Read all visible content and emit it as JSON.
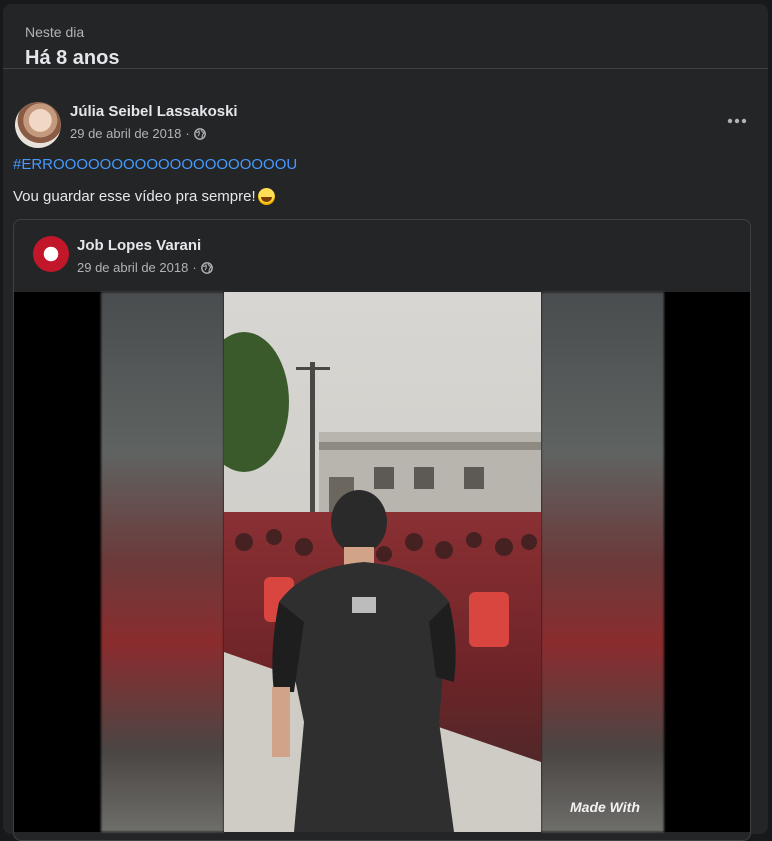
{
  "memory": {
    "kicker": "Neste dia",
    "title": "Há 8 anos"
  },
  "post": {
    "author": "Júlia Seibel Lassakoski",
    "date": "29 de abril de 2018",
    "separator": "·",
    "privacy_icon": "globe-icon",
    "more_icon": "more-options-icon",
    "hashtag": "#ERROOOOOOOOOOOOOOOOOOOOU",
    "text": "Vou guardar esse vídeo pra sempre!",
    "emoji": "laughing-emoji"
  },
  "shared_post": {
    "author": "Job Lopes Varani",
    "date": "29 de abril de 2018",
    "separator": "·",
    "privacy_icon": "globe-icon",
    "video_watermark": "Made With"
  },
  "colors": {
    "background": "#18191a",
    "card": "#242526",
    "hashtag": "#4599ff",
    "text_secondary": "#b0b3b8"
  }
}
